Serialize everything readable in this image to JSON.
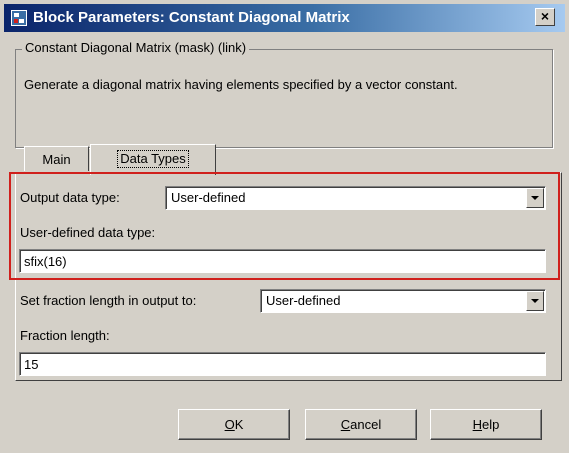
{
  "window": {
    "title": "Block Parameters: Constant Diagonal Matrix",
    "close_label": "×"
  },
  "group": {
    "legend": "Constant Diagonal Matrix (mask) (link)",
    "description": "Generate a diagonal matrix having elements specified by a vector constant."
  },
  "tabs": [
    {
      "label": "Main",
      "selected": false
    },
    {
      "label": "Data Types",
      "selected": true
    }
  ],
  "fields": {
    "output_data_type": {
      "label": "Output data type:",
      "value": "User-defined"
    },
    "user_defined_data_type": {
      "label": "User-defined data type:",
      "value": "sfix(16)"
    },
    "set_fraction_length": {
      "label": "Set fraction length in output to:",
      "value": "User-defined"
    },
    "fraction_length": {
      "label": "Fraction length:",
      "value": "15"
    }
  },
  "buttons": {
    "ok": {
      "mnemonic": "O",
      "rest": "K"
    },
    "cancel": {
      "mnemonic": "C",
      "rest": "ancel"
    },
    "help": {
      "mnemonic": "H",
      "rest": "elp"
    }
  },
  "colors": {
    "title_bar_start": "#0a246a",
    "title_bar_end": "#a6caf0",
    "dialog_face": "#d4d0c8",
    "highlight_box": "#d0201c"
  },
  "icons": {
    "title_icon": "simulink-block-icon",
    "close_icon": "close-icon",
    "dropdown_icon": "chevron-down-icon"
  }
}
